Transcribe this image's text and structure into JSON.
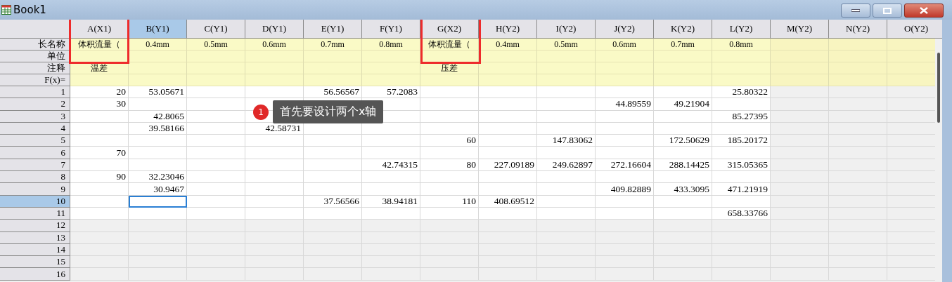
{
  "window": {
    "title": "Book1"
  },
  "columns": [
    {
      "label": "A(X1)",
      "selected": false,
      "long_name": "体积流量（",
      "comment": "温差"
    },
    {
      "label": "B(Y1)",
      "selected": true,
      "long_name": "0.4mm"
    },
    {
      "label": "C(Y1)",
      "selected": false,
      "long_name": "0.5mm"
    },
    {
      "label": "D(Y1)",
      "selected": false,
      "long_name": "0.6mm"
    },
    {
      "label": "E(Y1)",
      "selected": false,
      "long_name": "0.7mm"
    },
    {
      "label": "F(Y1)",
      "selected": false,
      "long_name": "0.8mm"
    },
    {
      "label": "G(X2)",
      "selected": false,
      "long_name": "体积流量（",
      "comment": "压差"
    },
    {
      "label": "H(Y2)",
      "selected": false,
      "long_name": "0.4mm"
    },
    {
      "label": "I(Y2)",
      "selected": false,
      "long_name": "0.5mm"
    },
    {
      "label": "J(Y2)",
      "selected": false,
      "long_name": "0.6mm"
    },
    {
      "label": "K(Y2)",
      "selected": false,
      "long_name": "0.7mm"
    },
    {
      "label": "L(Y2)",
      "selected": false,
      "long_name": "0.8mm"
    },
    {
      "label": "M(Y2)",
      "selected": false
    },
    {
      "label": "N(Y2)",
      "selected": false
    },
    {
      "label": "O(Y2)",
      "selected": false
    }
  ],
  "header_rows": [
    "长名称",
    "单位",
    "注释",
    "F(x)="
  ],
  "rows": [
    {
      "label": "1",
      "selected": false,
      "cells": [
        "20",
        "53.05671",
        null,
        null,
        "56.56567",
        "57.2083",
        null,
        null,
        null,
        null,
        null,
        "25.80322"
      ]
    },
    {
      "label": "2",
      "selected": false,
      "cells": [
        "30",
        null,
        null,
        null,
        null,
        null,
        null,
        null,
        null,
        "44.89559",
        "49.21904",
        null
      ]
    },
    {
      "label": "3",
      "selected": false,
      "cells": [
        null,
        "42.8065",
        null,
        null,
        null,
        null,
        null,
        null,
        null,
        null,
        null,
        "85.27395"
      ]
    },
    {
      "label": "4",
      "selected": false,
      "cells": [
        null,
        "39.58166",
        null,
        "42.58731",
        null,
        null,
        null,
        null,
        null,
        null,
        null,
        null
      ]
    },
    {
      "label": "5",
      "selected": false,
      "cells": [
        null,
        null,
        null,
        null,
        null,
        null,
        "60",
        null,
        "147.83062",
        null,
        "172.50629",
        "185.20172"
      ]
    },
    {
      "label": "6",
      "selected": false,
      "cells": [
        "70",
        null,
        null,
        null,
        null,
        null,
        null,
        null,
        null,
        null,
        null,
        null
      ]
    },
    {
      "label": "7",
      "selected": false,
      "cells": [
        null,
        null,
        null,
        null,
        null,
        "42.74315",
        "80",
        "227.09189",
        "249.62897",
        "272.16604",
        "288.14425",
        "315.05365"
      ]
    },
    {
      "label": "8",
      "selected": false,
      "cells": [
        "90",
        "32.23046",
        null,
        null,
        null,
        null,
        null,
        null,
        null,
        null,
        null,
        null
      ]
    },
    {
      "label": "9",
      "selected": false,
      "cells": [
        null,
        "30.9467",
        null,
        null,
        null,
        null,
        null,
        null,
        null,
        "409.82889",
        "433.3095",
        "471.21919"
      ]
    },
    {
      "label": "10",
      "selected": true,
      "cells": [
        null,
        null,
        null,
        null,
        "37.56566",
        "38.94181",
        "110",
        "408.69512",
        null,
        null,
        null,
        null
      ]
    },
    {
      "label": "11",
      "selected": false,
      "cells": [
        null,
        null,
        null,
        null,
        null,
        null,
        null,
        null,
        null,
        null,
        null,
        "658.33766"
      ]
    },
    {
      "label": "12",
      "selected": false
    },
    {
      "label": "13",
      "selected": false
    },
    {
      "label": "14",
      "selected": false
    },
    {
      "label": "15",
      "selected": false
    },
    {
      "label": "16",
      "selected": false
    }
  ],
  "callout": {
    "number": "1",
    "text": "首先要设计两个x轴"
  }
}
